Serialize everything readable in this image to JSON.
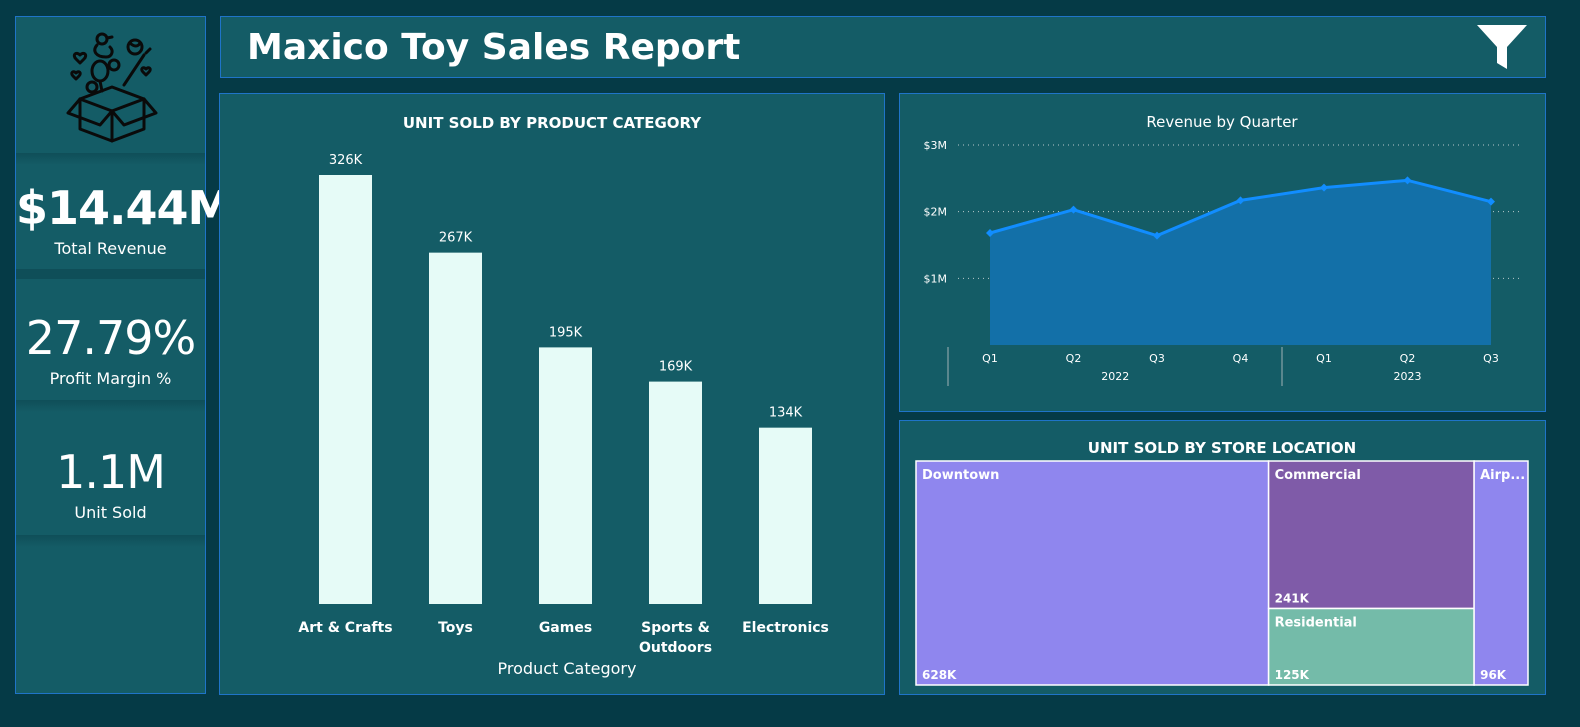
{
  "header": {
    "title": "Maxico Toy Sales Report"
  },
  "icons": {
    "logo": "toy-box-icon",
    "filter": "filter-icon"
  },
  "kpis": {
    "revenue": {
      "value": "$14.44M",
      "label": "Total Revenue"
    },
    "margin": {
      "value": "27.79%",
      "label": "Profit Margin %"
    },
    "units": {
      "value": "1.1M",
      "label": "Unit Sold"
    }
  },
  "colors": {
    "background": "#053a46",
    "panel": "#145c66",
    "panel_border": "#1f74c8",
    "bar": "#e6fbf7",
    "line": "#118dff",
    "area": "#1370a8",
    "downtown": "#8f86ee",
    "commercial": "#7f5ba8",
    "residential": "#74bba9",
    "airport": "#8f86ee"
  },
  "chart_data": [
    {
      "id": "category",
      "type": "bar",
      "title": "UNIT SOLD BY PRODUCT CATEGORY",
      "xlabel": "Product Category",
      "categories": [
        "Art & Crafts",
        "Toys",
        "Games",
        "Sports & Outdoors",
        "Electronics"
      ],
      "category_lines": [
        [
          "Art & Crafts"
        ],
        [
          "Toys"
        ],
        [
          "Games"
        ],
        [
          "Sports &",
          "Outdoors"
        ],
        [
          "Electronics"
        ]
      ],
      "values": [
        326,
        267,
        195,
        169,
        134
      ],
      "data_labels": [
        "326K",
        "267K",
        "195K",
        "169K",
        "134K"
      ],
      "unit": "thousands",
      "ylim": [
        0,
        326
      ]
    },
    {
      "id": "revenue",
      "type": "area",
      "title": "Revenue by Quarter",
      "x": [
        "Q1",
        "Q2",
        "Q3",
        "Q4",
        "Q1",
        "Q2",
        "Q3"
      ],
      "groups": [
        {
          "label": "2022",
          "count": 4
        },
        {
          "label": "2023",
          "count": 3
        }
      ],
      "values": [
        1.68,
        2.03,
        1.64,
        2.17,
        2.36,
        2.47,
        2.15
      ],
      "y_ticks": [
        {
          "value": 1,
          "label": "$1M"
        },
        {
          "value": 2,
          "label": "$2M"
        },
        {
          "value": 3,
          "label": "$3M"
        }
      ],
      "unit": "millions USD",
      "ylim": [
        0,
        3
      ],
      "grid": true
    },
    {
      "id": "location",
      "type": "treemap",
      "title": "UNIT SOLD BY STORE LOCATION",
      "items": [
        {
          "name": "Downtown",
          "value": 628,
          "label": "628K"
        },
        {
          "name": "Commercial",
          "value": 241,
          "label": "241K"
        },
        {
          "name": "Residential",
          "value": 125,
          "label": "125K"
        },
        {
          "name": "Airport",
          "display_name": "Airp...",
          "value": 96,
          "label": "96K"
        }
      ],
      "unit": "thousands"
    }
  ]
}
